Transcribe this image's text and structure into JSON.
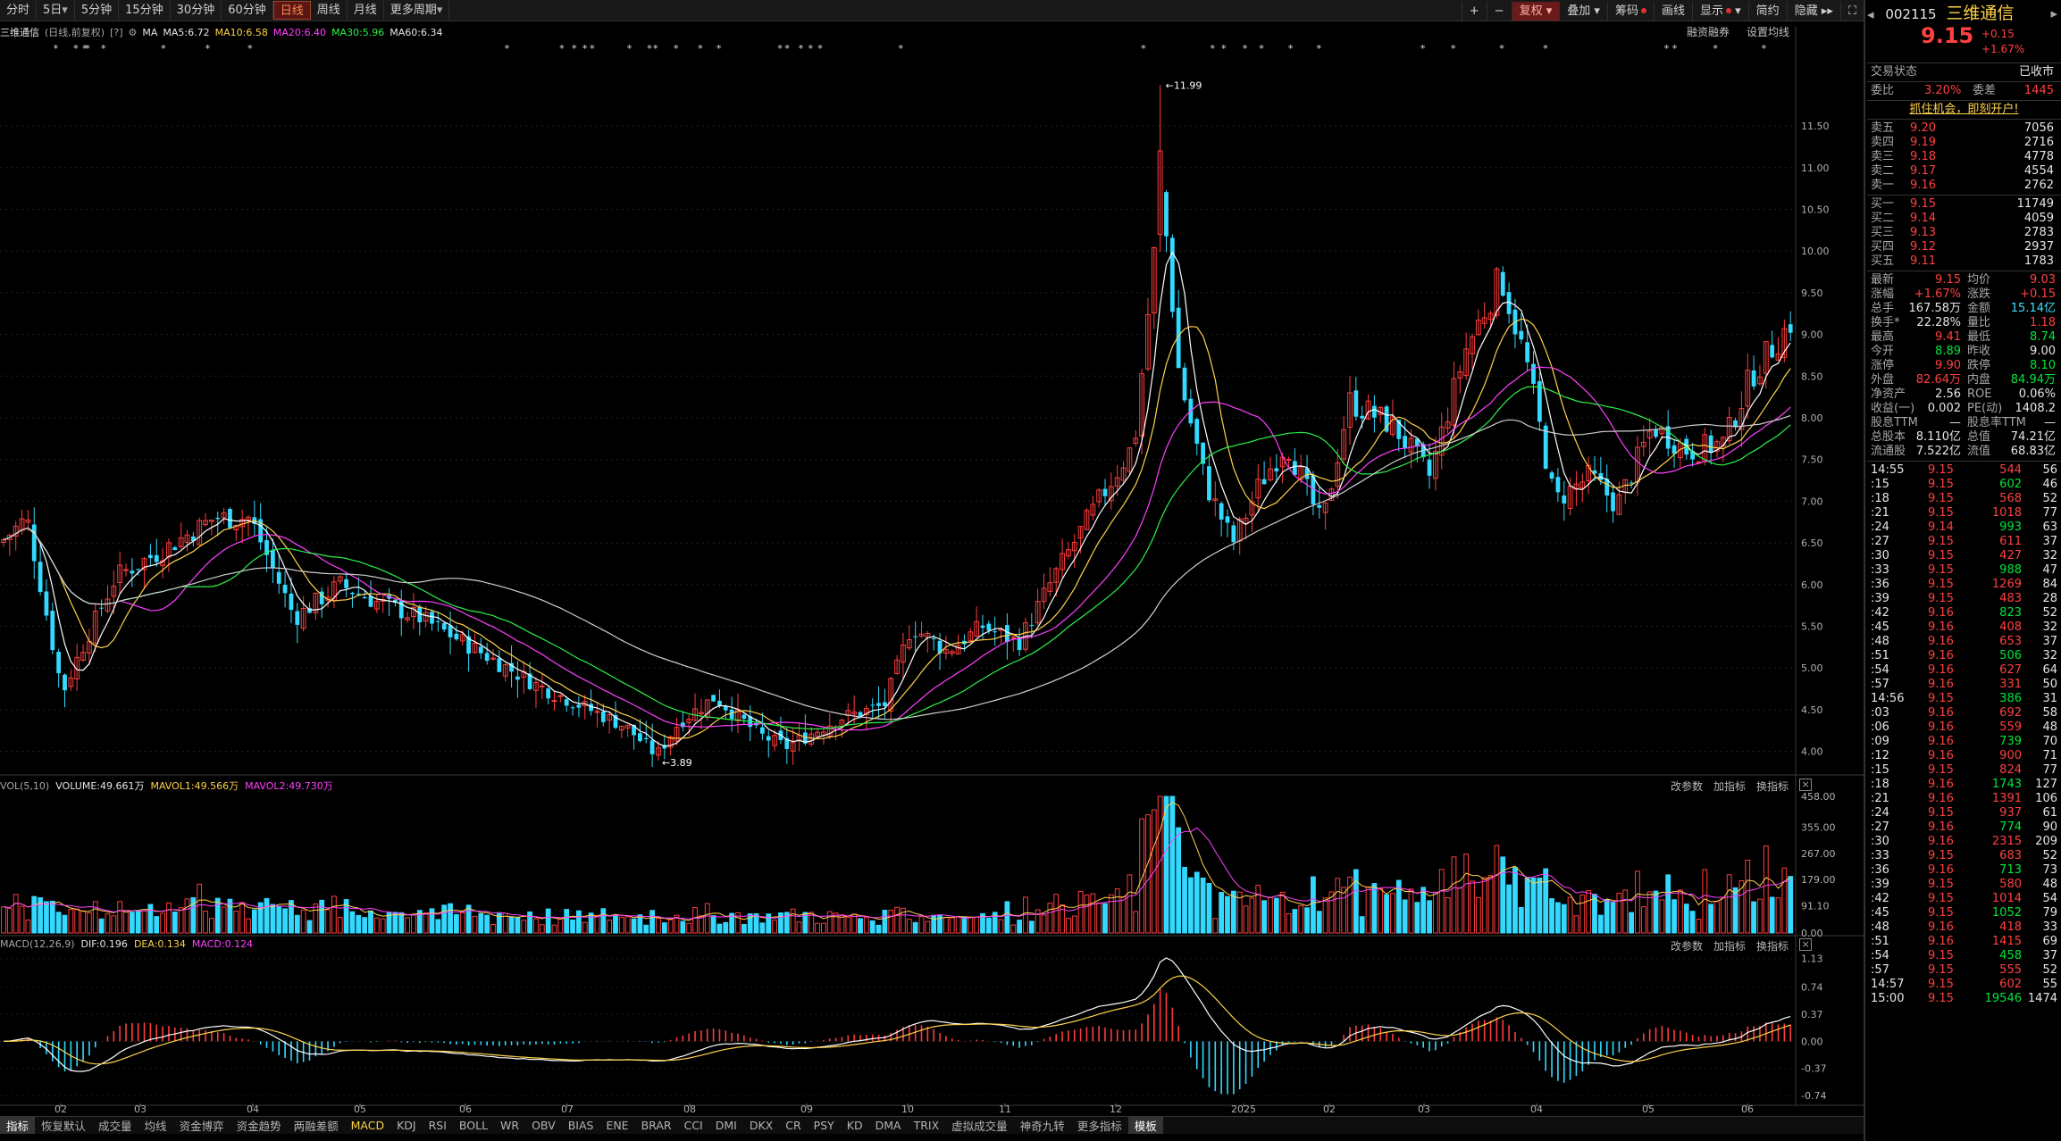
{
  "toolbar": {
    "periods": [
      "分时",
      "5日",
      "5分钟",
      "15分钟",
      "30分钟",
      "60分钟",
      "日线",
      "周线",
      "月线",
      "更多周期"
    ],
    "active_period": "日线",
    "right": [
      "+",
      "−",
      "复权",
      "叠加",
      "筹码",
      "画线",
      "显示",
      "简约",
      "隐藏"
    ]
  },
  "main_header": {
    "name": "三维通信",
    "desc": "(日线,前复权)",
    "ma_label": "MA",
    "ma5": "MA5:6.72",
    "ma10": "MA10:6.58",
    "ma20": "MA20:6.40",
    "ma30": "MA30:5.96",
    "ma60": "MA60:6.34",
    "right1": "融资融券",
    "right2": "设置均线"
  },
  "vol_header": {
    "label": "VOL(5,10)",
    "volume": "VOLUME:49.661万",
    "mav1": "MAVOL1:49.566万",
    "mav2": "MAVOL2:49.730万"
  },
  "macd_header": {
    "label": "MACD(12,26,9)",
    "dif": "DIF:0.196",
    "dea": "DEA:0.134",
    "macd": "MACD:0.124"
  },
  "panel_tools": [
    "改参数",
    "加指标",
    "换指标"
  ],
  "price_axis": [
    "11.50",
    "11.00",
    "10.50",
    "10.00",
    "9.50",
    "9.00",
    "8.50",
    "8.00",
    "7.50",
    "7.00",
    "6.50",
    "6.00",
    "5.50",
    "5.00",
    "4.50",
    "4.00"
  ],
  "vol_axis": [
    "458.00",
    "355.00",
    "267.00",
    "179.00",
    "91.10",
    "0.00"
  ],
  "macd_axis": [
    "1.13",
    "0.74",
    "0.37",
    "0.00",
    "-0.37",
    "-0.74"
  ],
  "x_labels": [
    "02",
    "03",
    "04",
    "05",
    "06",
    "07",
    "08",
    "09",
    "10",
    "11",
    "12",
    "2025",
    "02",
    "03",
    "04",
    "05",
    "06"
  ],
  "hi_label": "11.99",
  "lo_label": "3.89",
  "bottom_tabs": [
    "指标",
    "恢复默认",
    "成交量",
    "均线",
    "资金博弈",
    "资金趋势",
    "两融差额",
    "MACD",
    "KDJ",
    "RSI",
    "BOLL",
    "WR",
    "OBV",
    "BIAS",
    "ENE",
    "BRAR",
    "CCI",
    "DMI",
    "DKX",
    "CR",
    "PSY",
    "KD",
    "DMA",
    "TRIX",
    "虚拟成交量",
    "神奇九转",
    "更多指标",
    "模板"
  ],
  "active_tab": "MACD",
  "stock": {
    "code": "002115",
    "name": "三维通信",
    "price": "9.15",
    "change": "+0.15",
    "pct": "+1.67%"
  },
  "status": {
    "label": "交易状态",
    "value": "已收市"
  },
  "weibi": {
    "l1": "委比",
    "v1": "3.20%",
    "l2": "委差",
    "v2": "1445"
  },
  "promo": "抓住机会，即刻开户!",
  "asks": [
    [
      "卖五",
      "9.20",
      "7056"
    ],
    [
      "卖四",
      "9.19",
      "2716"
    ],
    [
      "卖三",
      "9.18",
      "4778"
    ],
    [
      "卖二",
      "9.17",
      "4554"
    ],
    [
      "卖一",
      "9.16",
      "2762"
    ]
  ],
  "bids": [
    [
      "买一",
      "9.15",
      "11749"
    ],
    [
      "买二",
      "9.14",
      "4059"
    ],
    [
      "买三",
      "9.13",
      "2783"
    ],
    [
      "买四",
      "9.12",
      "2937"
    ],
    [
      "买五",
      "9.11",
      "1783"
    ]
  ],
  "quote": [
    [
      "最新",
      "9.15",
      "均价",
      "9.03"
    ],
    [
      "涨幅",
      "+1.67%",
      "涨跌",
      "+0.15"
    ],
    [
      "总手",
      "167.58万",
      "金额",
      "15.14亿"
    ],
    [
      "换手*",
      "22.28%",
      "量比",
      "1.18"
    ],
    [
      "最高",
      "9.41",
      "最低",
      "8.74"
    ],
    [
      "今开",
      "8.89",
      "昨收",
      "9.00"
    ],
    [
      "涨停",
      "9.90",
      "跌停",
      "8.10"
    ],
    [
      "外盘",
      "82.64万",
      "内盘",
      "84.94万"
    ],
    [
      "净资产",
      "2.56",
      "ROE",
      "0.06%"
    ],
    [
      "收益(一)",
      "0.002",
      "PE(动)",
      "1408.2"
    ],
    [
      "股息TTM",
      "—",
      "股息率TTM",
      "—"
    ],
    [
      "总股本",
      "8.110亿",
      "总值",
      "74.21亿"
    ],
    [
      "流通股",
      "7.522亿",
      "流值",
      "68.83亿"
    ]
  ],
  "ticks": [
    [
      "14:55",
      "9.15",
      "544",
      "56"
    ],
    [
      ":15",
      "9.15",
      "602",
      "46"
    ],
    [
      ":18",
      "9.15",
      "568",
      "52"
    ],
    [
      ":21",
      "9.15",
      "1018",
      "77"
    ],
    [
      ":24",
      "9.14",
      "993",
      "63"
    ],
    [
      ":27",
      "9.15",
      "611",
      "37"
    ],
    [
      ":30",
      "9.15",
      "427",
      "32"
    ],
    [
      ":33",
      "9.15",
      "988",
      "47"
    ],
    [
      ":36",
      "9.15",
      "1269",
      "84"
    ],
    [
      ":39",
      "9.15",
      "483",
      "28"
    ],
    [
      ":42",
      "9.16",
      "823",
      "52"
    ],
    [
      ":45",
      "9.16",
      "408",
      "32"
    ],
    [
      ":48",
      "9.16",
      "653",
      "37"
    ],
    [
      ":51",
      "9.16",
      "506",
      "32"
    ],
    [
      ":54",
      "9.16",
      "627",
      "64"
    ],
    [
      ":57",
      "9.16",
      "331",
      "50"
    ],
    [
      "14:56",
      "9.15",
      "386",
      "31"
    ],
    [
      ":03",
      "9.16",
      "692",
      "58"
    ],
    [
      ":06",
      "9.16",
      "559",
      "48"
    ],
    [
      ":09",
      "9.16",
      "739",
      "70"
    ],
    [
      ":12",
      "9.16",
      "900",
      "71"
    ],
    [
      ":15",
      "9.15",
      "824",
      "77"
    ],
    [
      ":18",
      "9.16",
      "1743",
      "127"
    ],
    [
      ":21",
      "9.16",
      "1391",
      "106"
    ],
    [
      ":24",
      "9.15",
      "937",
      "61"
    ],
    [
      ":27",
      "9.16",
      "774",
      "90"
    ],
    [
      ":30",
      "9.16",
      "2315",
      "209"
    ],
    [
      ":33",
      "9.15",
      "683",
      "52"
    ],
    [
      ":36",
      "9.16",
      "713",
      "73"
    ],
    [
      ":39",
      "9.15",
      "580",
      "48"
    ],
    [
      ":42",
      "9.15",
      "1014",
      "54"
    ],
    [
      ":45",
      "9.15",
      "1052",
      "79"
    ],
    [
      ":48",
      "9.16",
      "418",
      "33"
    ],
    [
      ":51",
      "9.16",
      "1415",
      "69"
    ],
    [
      ":54",
      "9.15",
      "458",
      "37"
    ],
    [
      ":57",
      "9.15",
      "555",
      "52"
    ],
    [
      "14:57",
      "9.15",
      "602",
      "55"
    ],
    [
      "15:00",
      "9.15",
      "19546",
      "1474"
    ]
  ]
}
